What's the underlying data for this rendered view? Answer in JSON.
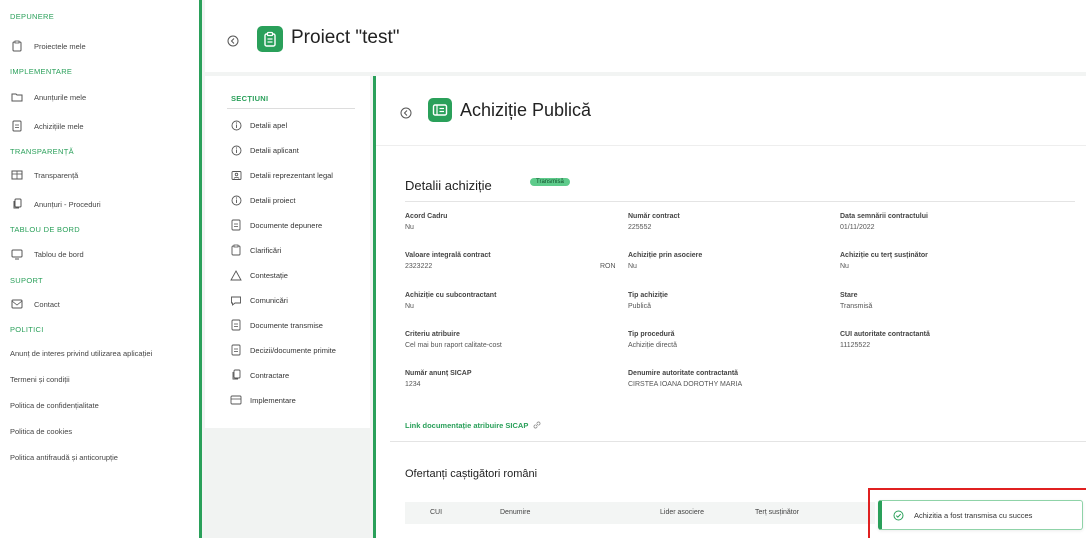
{
  "sidebar": {
    "sections": {
      "depunere": "DEPUNERE",
      "implementare": "IMPLEMENTARE",
      "transparenta": "TRANSPARENȚĂ",
      "tablou": "TABLOU DE BORD",
      "suport": "SUPORT",
      "politici": "POLITICI"
    },
    "items": {
      "proiectele_mele": "Proiectele mele",
      "anunturile_mele": "Anunțurile mele",
      "achizitiile_mele": "Achizițiile mele",
      "transparenta": "Transparență",
      "anunturi_proceduri": "Anunțuri - Proceduri",
      "tablou_de_bord": "Tablou de bord",
      "contact": "Contact",
      "anunt_interes": "Anunț de interes privind utilizarea aplicației",
      "termeni": "Termeni și condiții",
      "confidentialitate": "Politica de confidențialitate",
      "cookies": "Politica de cookies",
      "antifrauda": "Politica antifraudă și anticorupție"
    }
  },
  "header": {
    "title": "Proiect \"test\""
  },
  "sections_panel": {
    "heading": "SECȚIUNI",
    "items": [
      "Detalii apel",
      "Detalii aplicant",
      "Detalii reprezentant legal",
      "Detalii proiect",
      "Documente depunere",
      "Clarificări",
      "Contestație",
      "Comunicări",
      "Documente transmise",
      "Decizii/documente primite",
      "Contractare",
      "Implementare"
    ]
  },
  "main": {
    "title": "Achiziție Publică",
    "card_title": "Detalii achiziție",
    "status": "Transmisă",
    "fields": {
      "acord_cadru": {
        "label": "Acord Cadru",
        "value": "Nu"
      },
      "numar_contract": {
        "label": "Număr contract",
        "value": "225552"
      },
      "data_semnarii": {
        "label": "Data semnării contractului",
        "value": "01/11/2022"
      },
      "valoare": {
        "label": "Valoare integrală contract",
        "value": "2323222",
        "currency": "RON"
      },
      "prin_asociere": {
        "label": "Achiziție prin asociere",
        "value": "Nu"
      },
      "tert_sustinator": {
        "label": "Achiziție cu terț susținător",
        "value": "Nu"
      },
      "subcontractant": {
        "label": "Achiziție cu subcontractant",
        "value": "Nu"
      },
      "tip_achizitie": {
        "label": "Tip achiziție",
        "value": "Publică"
      },
      "stare": {
        "label": "Stare",
        "value": "Transmisă"
      },
      "criteriu": {
        "label": "Criteriu atribuire",
        "value": "Cel mai bun raport calitate-cost"
      },
      "tip_procedura": {
        "label": "Tip procedură",
        "value": "Achiziție directă"
      },
      "cui_autoritate": {
        "label": "CUI autoritate contractantă",
        "value": "11125522"
      },
      "numar_anunt": {
        "label": "Număr anunț SICAP",
        "value": "1234"
      },
      "denumire_autoritate": {
        "label": "Denumire autoritate contractantă",
        "value": "CIRSTEA IOANA DOROTHY MARIA"
      }
    },
    "sicap_link": "Link documentație atribuire SICAP",
    "ofertanti_title": "Ofertanți caștigători români",
    "table": {
      "columns": [
        "CUI",
        "Denumire",
        "Lider asociere",
        "Terț susținător"
      ]
    }
  },
  "toast": {
    "message": "Achizitia a fost transmisa cu succes"
  },
  "colors": {
    "accent": "#2aa05a",
    "highlight_frame": "#e02020"
  }
}
